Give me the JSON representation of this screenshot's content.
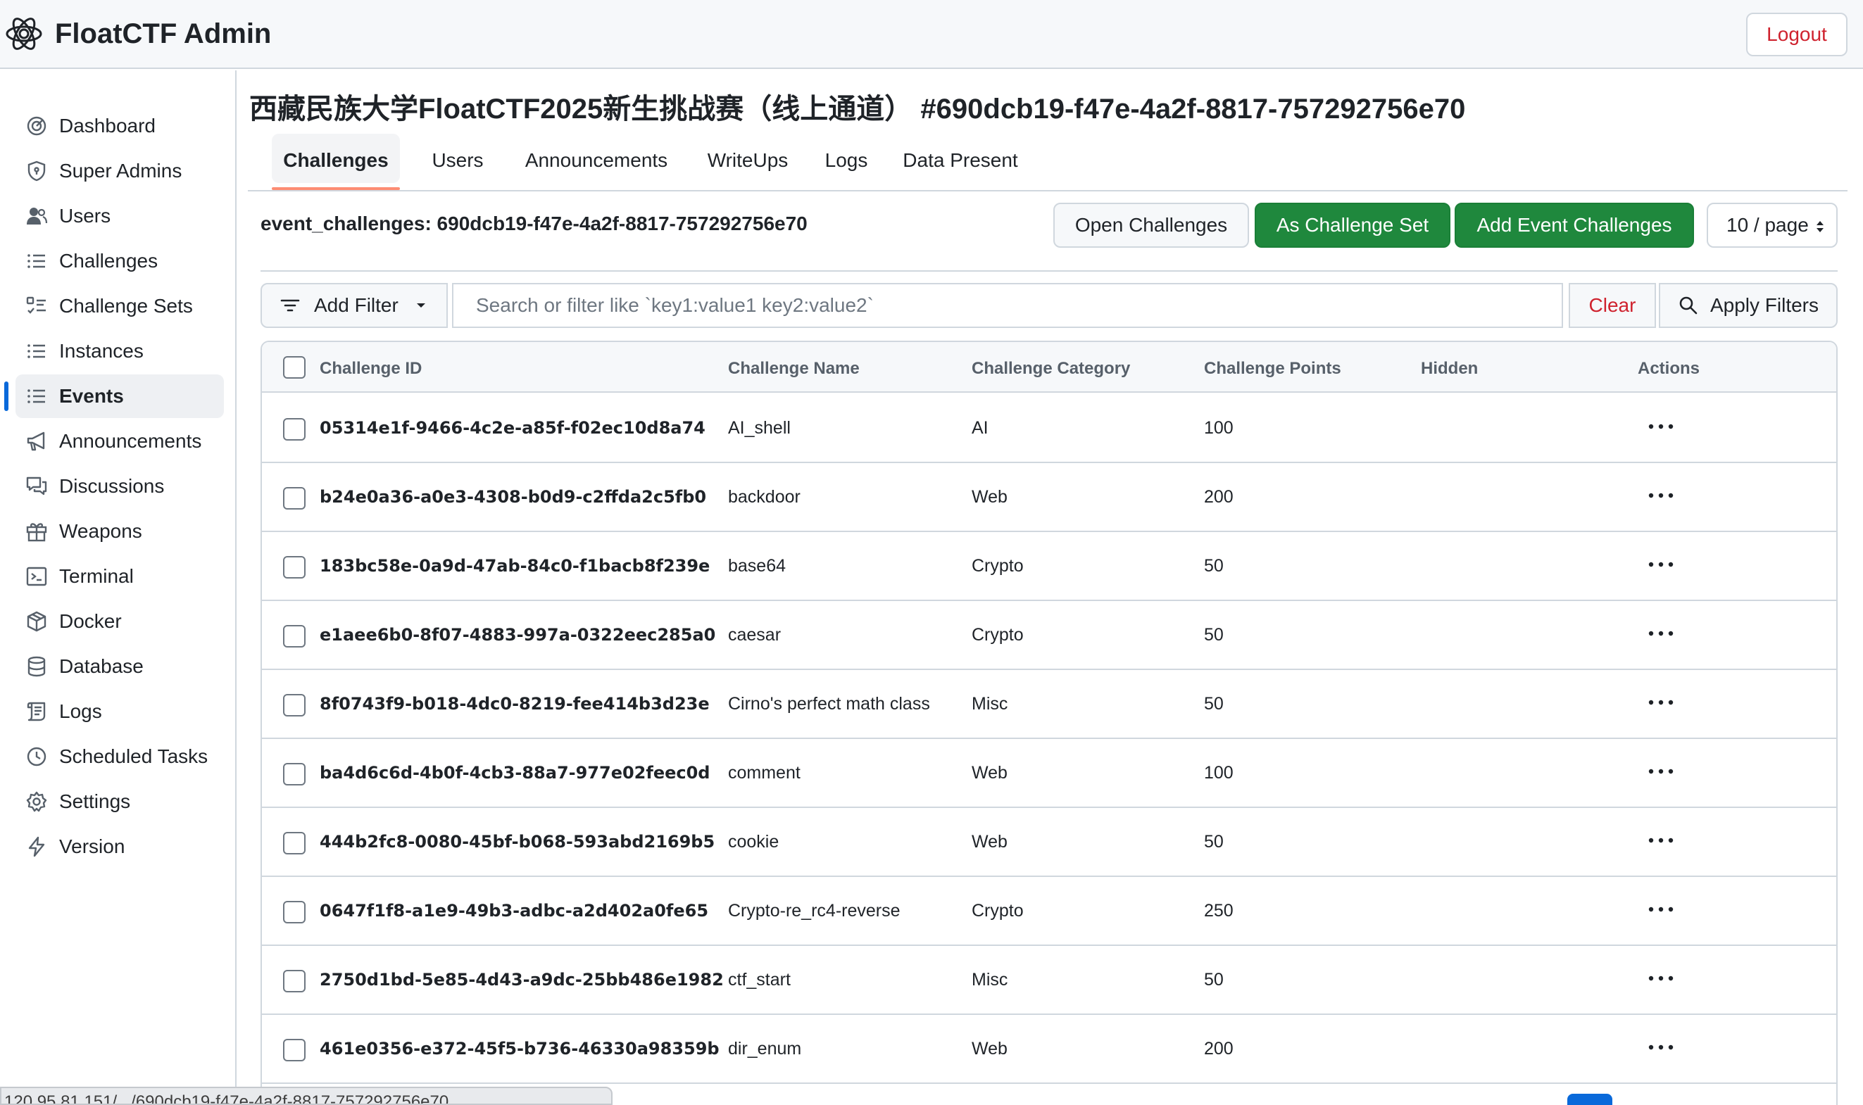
{
  "app": {
    "title": "FloatCTF Admin",
    "logout_label": "Logout"
  },
  "sidebar": {
    "items": [
      {
        "label": "Dashboard",
        "icon": "gauge-icon"
      },
      {
        "label": "Super Admins",
        "icon": "shield-icon"
      },
      {
        "label": "Users",
        "icon": "users-icon"
      },
      {
        "label": "Challenges",
        "icon": "list-icon"
      },
      {
        "label": "Challenge Sets",
        "icon": "checklist-icon"
      },
      {
        "label": "Instances",
        "icon": "list-icon"
      },
      {
        "label": "Events",
        "icon": "list-icon",
        "active": true
      },
      {
        "label": "Announcements",
        "icon": "megaphone-icon"
      },
      {
        "label": "Discussions",
        "icon": "discussions-icon"
      },
      {
        "label": "Weapons",
        "icon": "gift-icon"
      },
      {
        "label": "Terminal",
        "icon": "terminal-icon"
      },
      {
        "label": "Docker",
        "icon": "package-icon"
      },
      {
        "label": "Database",
        "icon": "database-icon"
      },
      {
        "label": "Logs",
        "icon": "log-icon"
      },
      {
        "label": "Scheduled Tasks",
        "icon": "clock-icon"
      },
      {
        "label": "Settings",
        "icon": "gear-icon"
      },
      {
        "label": "Version",
        "icon": "zap-icon"
      }
    ]
  },
  "page": {
    "title": "西藏民族大学FloatCTF2025新生挑战赛（线上通道） #690dcb19-f47e-4a2f-8817-757292756e70",
    "tabs": [
      "Challenges",
      "Users",
      "Announcements",
      "WriteUps",
      "Logs",
      "Data Present"
    ],
    "active_tab": "Challenges"
  },
  "toolbar": {
    "section_title": "event_challenges: 690dcb19-f47e-4a2f-8817-757292756e70",
    "open_challenges_label": "Open Challenges",
    "as_challenge_set_label": "As Challenge Set",
    "add_event_challenges_label": "Add Event Challenges",
    "page_size": "10 / page"
  },
  "filter": {
    "add_filter_label": "Add Filter",
    "placeholder": "Search or filter like `key1:value1 key2:value2`",
    "value": "",
    "clear_label": "Clear",
    "apply_label": "Apply Filters"
  },
  "table": {
    "columns": [
      "Challenge ID",
      "Challenge Name",
      "Challenge Category",
      "Challenge Points",
      "Hidden",
      "Actions"
    ],
    "rows": [
      {
        "id": "05314e1f-9466-4c2e-a85f-f02ec10d8a74",
        "name": "AI_shell",
        "category": "AI",
        "points": "100",
        "hidden": ""
      },
      {
        "id": "b24e0a36-a0e3-4308-b0d9-c2ffda2c5fb0",
        "name": "backdoor",
        "category": "Web",
        "points": "200",
        "hidden": ""
      },
      {
        "id": "183bc58e-0a9d-47ab-84c0-f1bacb8f239e",
        "name": "base64",
        "category": "Crypto",
        "points": "50",
        "hidden": ""
      },
      {
        "id": "e1aee6b0-8f07-4883-997a-0322eec285a0",
        "name": "caesar",
        "category": "Crypto",
        "points": "50",
        "hidden": ""
      },
      {
        "id": "8f0743f9-b018-4dc0-8219-fee414b3d23e",
        "name": "Cirno's perfect math class",
        "category": "Misc",
        "points": "50",
        "hidden": ""
      },
      {
        "id": "ba4d6c6d-4b0f-4cb3-88a7-977e02feec0d",
        "name": "comment",
        "category": "Web",
        "points": "100",
        "hidden": ""
      },
      {
        "id": "444b2fc8-0080-45bf-b068-593abd2169b5",
        "name": "cookie",
        "category": "Web",
        "points": "50",
        "hidden": ""
      },
      {
        "id": "0647f1f8-a1e9-49b3-adbc-a2d402a0fe65",
        "name": "Crypto-re_rc4-reverse",
        "category": "Crypto",
        "points": "250",
        "hidden": ""
      },
      {
        "id": "2750d1bd-5e85-4d43-a9dc-25bb486e1982",
        "name": "ctf_start",
        "category": "Misc",
        "points": "50",
        "hidden": ""
      },
      {
        "id": "461e0356-e372-45f5-b736-46330a98359b",
        "name": "dir_enum",
        "category": "Web",
        "points": "200",
        "hidden": ""
      }
    ]
  },
  "statusbar": {
    "url": "120.95.81.151/.../690dcb19-f47e-4a2f-8817-757292756e70"
  },
  "colors": {
    "green": "#1f883d",
    "danger": "#cf222e",
    "accent": "#0969da",
    "tab_underline": "#fd8c73"
  }
}
